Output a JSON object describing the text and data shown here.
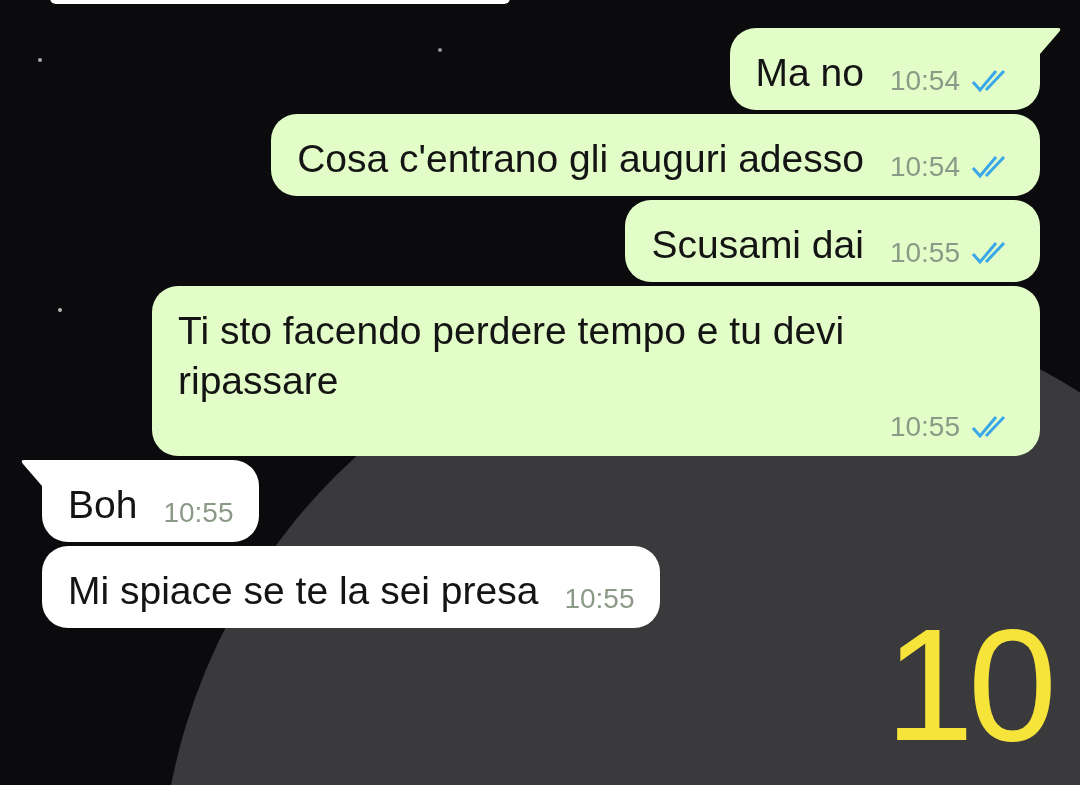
{
  "messages": [
    {
      "kind": "out",
      "text": "Ma no",
      "time": "10:54",
      "read": true,
      "tail": true
    },
    {
      "kind": "out",
      "text": "Cosa c'entrano gli auguri adesso",
      "time": "10:54",
      "read": true,
      "tail": false
    },
    {
      "kind": "out",
      "text": "Scusami dai",
      "time": "10:55",
      "read": true,
      "tail": false
    },
    {
      "kind": "out",
      "text": "Ti sto facendo perdere tempo e tu devi ripassare",
      "time": "10:55",
      "read": true,
      "tail": false
    },
    {
      "kind": "in",
      "text": "Boh",
      "time": "10:55",
      "tail": true
    },
    {
      "kind": "in",
      "text": "Mi spiace se te la sei presa",
      "time": "10:55",
      "tail": false
    }
  ],
  "annotation": "10"
}
